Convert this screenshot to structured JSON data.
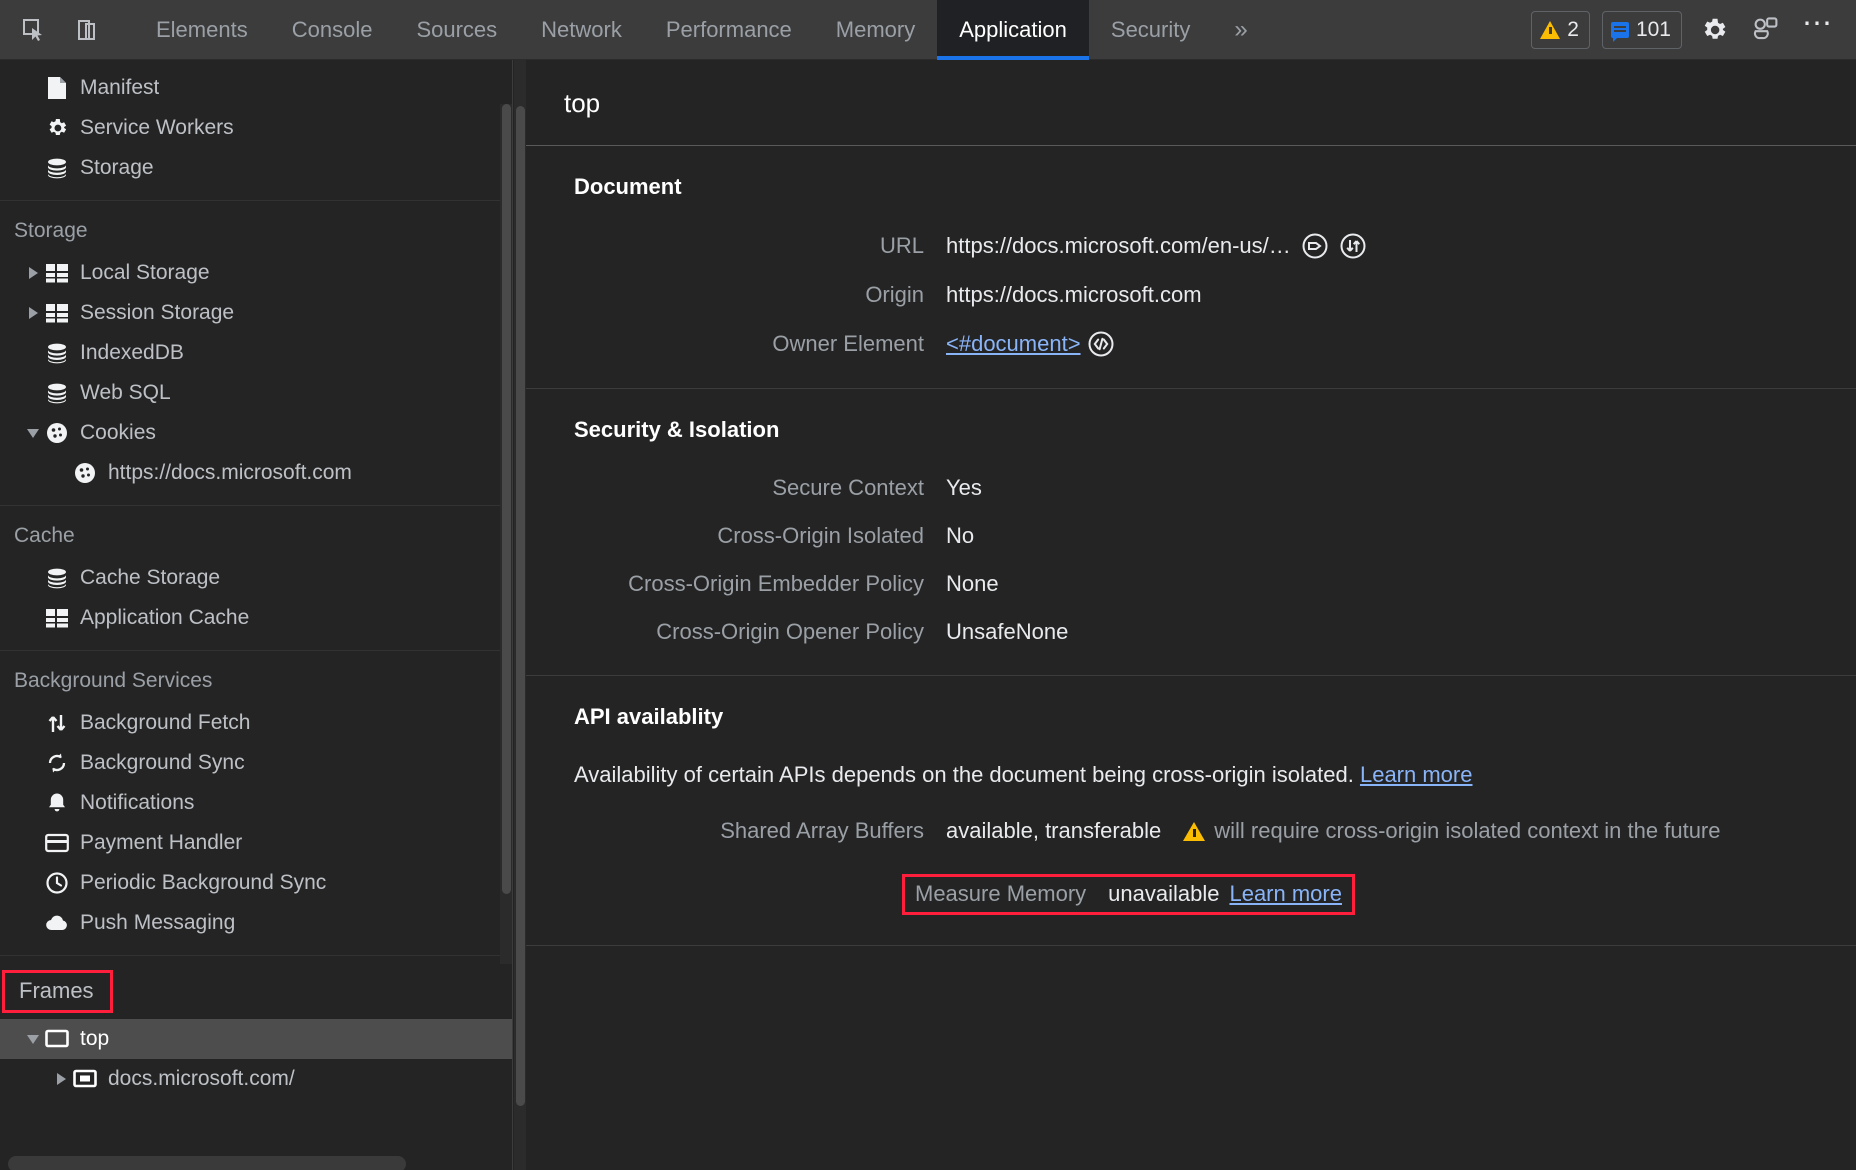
{
  "toolbar": {
    "inspect_icon": "inspect-cursor-icon",
    "device_icon": "device-toggle-icon",
    "tabs": [
      {
        "label": "Elements",
        "selected": false
      },
      {
        "label": "Console",
        "selected": false
      },
      {
        "label": "Sources",
        "selected": false
      },
      {
        "label": "Network",
        "selected": false
      },
      {
        "label": "Performance",
        "selected": false
      },
      {
        "label": "Memory",
        "selected": false
      },
      {
        "label": "Application",
        "selected": true
      },
      {
        "label": "Security",
        "selected": false
      }
    ],
    "more_tabs_glyph": "»",
    "warning_count": "2",
    "message_count": "101",
    "settings_icon": "gear-icon",
    "devices_icon": "devices-icon",
    "more_options_glyph": "⋯",
    "accent_color": "#1a73e8",
    "warning_color": "#fbbc04",
    "message_color": "#1a73e8"
  },
  "sidebar": {
    "application_items": [
      {
        "label": "Manifest",
        "icon": "manifest-document-icon",
        "indent": 1,
        "arrow": "none"
      },
      {
        "label": "Service Workers",
        "icon": "gear-icon",
        "indent": 1,
        "arrow": "none"
      },
      {
        "label": "Storage",
        "icon": "database-icon",
        "indent": 1,
        "arrow": "none"
      }
    ],
    "groups": [
      {
        "title": "Storage",
        "items": [
          {
            "label": "Local Storage",
            "icon": "table-icon",
            "indent": 1,
            "arrow": "right"
          },
          {
            "label": "Session Storage",
            "icon": "table-icon",
            "indent": 1,
            "arrow": "right"
          },
          {
            "label": "IndexedDB",
            "icon": "database-icon",
            "indent": 1,
            "arrow": "none"
          },
          {
            "label": "Web SQL",
            "icon": "database-icon",
            "indent": 1,
            "arrow": "none"
          },
          {
            "label": "Cookies",
            "icon": "cookie-icon",
            "indent": 1,
            "arrow": "down"
          },
          {
            "label": "https://docs.microsoft.com",
            "icon": "cookie-icon",
            "indent": 2,
            "arrow": "none"
          }
        ]
      },
      {
        "title": "Cache",
        "items": [
          {
            "label": "Cache Storage",
            "icon": "database-icon",
            "indent": 1,
            "arrow": "none"
          },
          {
            "label": "Application Cache",
            "icon": "table-icon",
            "indent": 1,
            "arrow": "none"
          }
        ]
      },
      {
        "title": "Background Services",
        "items": [
          {
            "label": "Background Fetch",
            "icon": "arrows-up-down-icon",
            "indent": 1,
            "arrow": "none"
          },
          {
            "label": "Background Sync",
            "icon": "sync-icon",
            "indent": 1,
            "arrow": "none"
          },
          {
            "label": "Notifications",
            "icon": "bell-icon",
            "indent": 1,
            "arrow": "none"
          },
          {
            "label": "Payment Handler",
            "icon": "credit-card-icon",
            "indent": 1,
            "arrow": "none"
          },
          {
            "label": "Periodic Background Sync",
            "icon": "clock-icon",
            "indent": 1,
            "arrow": "none"
          },
          {
            "label": "Push Messaging",
            "icon": "cloud-icon",
            "indent": 1,
            "arrow": "none"
          }
        ]
      }
    ],
    "frames": {
      "title": "Frames",
      "highlight_color": "#ff1f3d",
      "items": [
        {
          "label": "top",
          "icon": "frame-icon",
          "indent": 1,
          "arrow": "down",
          "selected": true
        },
        {
          "label": "docs.microsoft.com/",
          "icon": "iframe-icon",
          "indent": 2,
          "arrow": "right",
          "selected": false
        }
      ]
    }
  },
  "main": {
    "frame_title": "top",
    "document_section": {
      "title": "Document",
      "rows": [
        {
          "label": "URL",
          "value": "https://docs.microsoft.com/en-us/…",
          "icons": [
            "tag-circle-icon",
            "download-arrow-circle-icon"
          ]
        },
        {
          "label": "Origin",
          "value": "https://docs.microsoft.com",
          "icons": []
        },
        {
          "label": "Owner Element",
          "value": "<#document>",
          "link": true,
          "icons": [
            "code-circle-icon"
          ]
        }
      ]
    },
    "security_section": {
      "title": "Security & Isolation",
      "rows": [
        {
          "label": "Secure Context",
          "value": "Yes"
        },
        {
          "label": "Cross-Origin Isolated",
          "value": "No"
        },
        {
          "label": "Cross-Origin Embedder Policy",
          "value": "None"
        },
        {
          "label": "Cross-Origin Opener Policy",
          "value": "UnsafeNone"
        }
      ]
    },
    "api_section": {
      "title": "API availablity",
      "description": "Availability of certain APIs depends on the document being cross-origin isolated.",
      "description_link": "Learn more",
      "shared_array_buffers": {
        "label": "Shared Array Buffers",
        "value": "available, transferable",
        "warning_icon": "warning-triangle-icon",
        "warning_text": "will require cross-origin isolated context in the future"
      },
      "measure_memory": {
        "label": "Measure Memory",
        "value": "unavailable",
        "link": "Learn more",
        "highlight_color": "#ff1f3d"
      }
    }
  }
}
